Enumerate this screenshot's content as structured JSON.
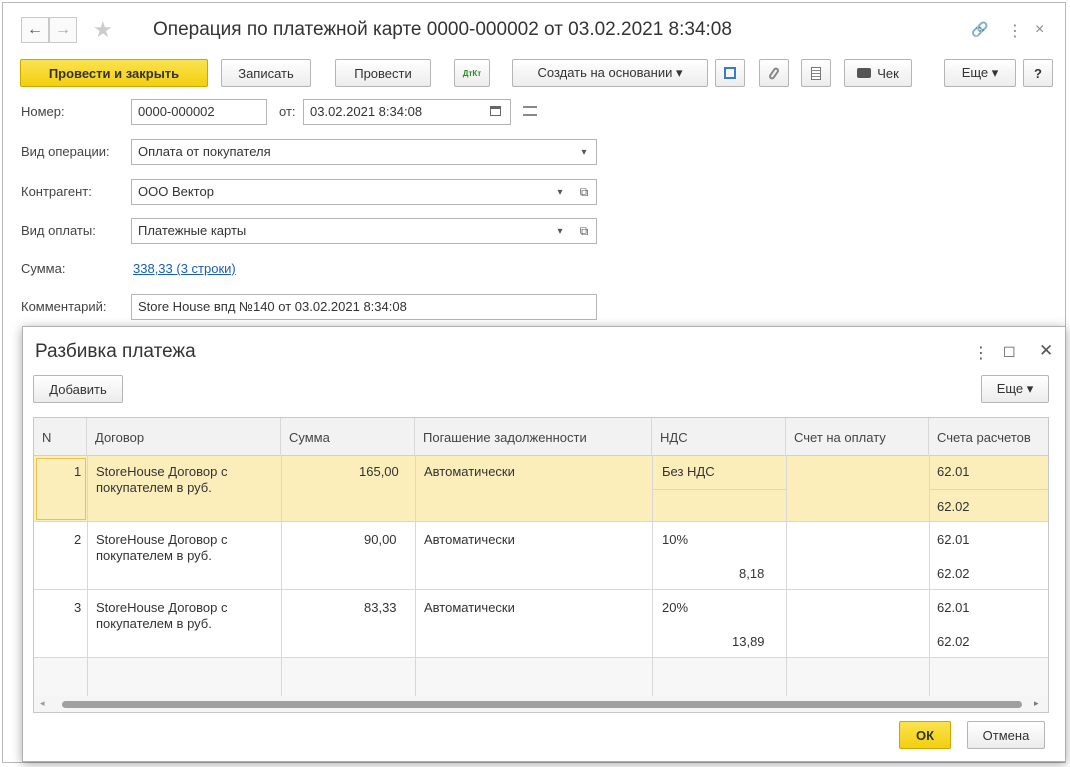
{
  "window": {
    "title": "Операция по платежной карте 0000-000002 от 03.02.2021 8:34:08",
    "back_icon": "←",
    "forward_icon": "→",
    "star_icon": "★",
    "link_icon": "🔗",
    "more_icon": "⋮",
    "close_icon": "×"
  },
  "toolbar": {
    "post_close": "Провести и закрыть",
    "save": "Записать",
    "post": "Провести",
    "dtkt": "ДтКт",
    "create_based": "Создать на основании ▾",
    "receipt": "Чек",
    "more": "Еще ▾",
    "help": "?"
  },
  "form": {
    "number_label": "Номер:",
    "number_value": "0000-000002",
    "from_label": "от:",
    "date_value": "03.02.2021  8:34:08",
    "op_type_label": "Вид операции:",
    "op_type_value": "Оплата от покупателя",
    "counterparty_label": "Контрагент:",
    "counterparty_value": "ООО Вектор",
    "payment_type_label": "Вид оплаты:",
    "payment_type_value": "Платежные карты",
    "amount_label": "Сумма:",
    "amount_link": "338,33 (3 строки)",
    "comment_label": "Комментарий:",
    "comment_value": "Store House впд №140 от 03.02.2021 8:34:08"
  },
  "dialog": {
    "title": "Разбивка платежа",
    "more_icon": "⋮",
    "maximize_icon": "☐",
    "close_icon": "✕",
    "add": "Добавить",
    "more": "Еще ▾",
    "ok": "ОК",
    "cancel": "Отмена",
    "columns": [
      "N",
      "Договор",
      "Сумма",
      "Погашение задолженности",
      "НДС",
      "Счет на оплату",
      "Счета расчетов"
    ],
    "rows": [
      {
        "n": "1",
        "contract_l1": "StoreHouse Договор с",
        "contract_l2": "покупателем в руб.",
        "sum": "165,00",
        "repay": "Автоматически",
        "vat": "Без НДС",
        "vat_amount": "",
        "invoice": "",
        "acc1": "62.01",
        "acc2": "62.02"
      },
      {
        "n": "2",
        "contract_l1": "StoreHouse Договор с",
        "contract_l2": "покупателем в руб.",
        "sum": "90,00",
        "repay": "Автоматически",
        "vat": "10%",
        "vat_amount": "8,18",
        "invoice": "",
        "acc1": "62.01",
        "acc2": "62.02"
      },
      {
        "n": "3",
        "contract_l1": "StoreHouse Договор с",
        "contract_l2": "покупателем в руб.",
        "sum": "83,33",
        "repay": "Автоматически",
        "vat": "20%",
        "vat_amount": "13,89",
        "invoice": "",
        "acc1": "62.01",
        "acc2": "62.02"
      }
    ]
  }
}
